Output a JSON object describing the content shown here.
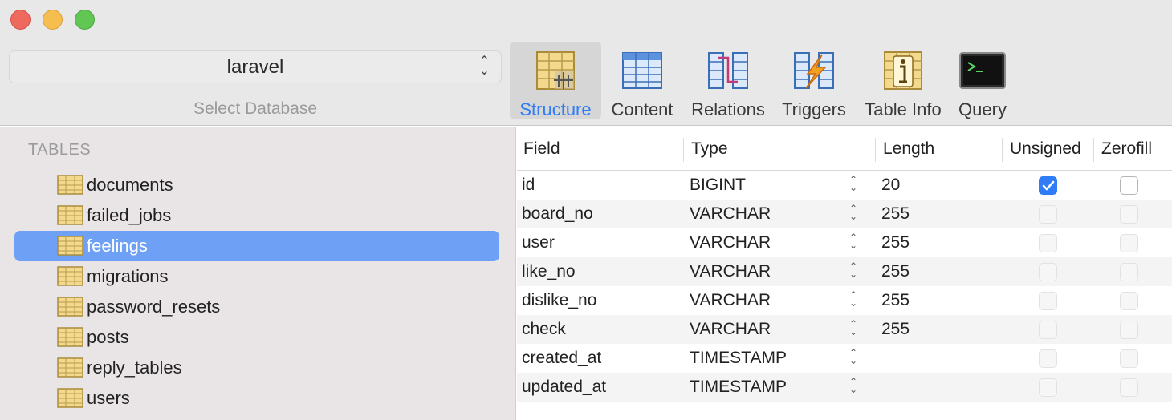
{
  "toolbar": {
    "database": {
      "value": "laravel",
      "caption": "Select Database"
    },
    "tools": [
      {
        "label": "Structure",
        "icon": "structure-icon",
        "active": true
      },
      {
        "label": "Content",
        "icon": "content-icon"
      },
      {
        "label": "Relations",
        "icon": "relations-icon"
      },
      {
        "label": "Triggers",
        "icon": "triggers-icon"
      },
      {
        "label": "Table Info",
        "icon": "table-info-icon"
      },
      {
        "label": "Query",
        "icon": "query-icon"
      }
    ]
  },
  "sidebar": {
    "heading": "TABLES",
    "tables": [
      "documents",
      "failed_jobs",
      "feelings",
      "migrations",
      "password_resets",
      "posts",
      "reply_tables",
      "users"
    ],
    "selected": "feelings"
  },
  "structure": {
    "columns": [
      "Field",
      "Type",
      "Length",
      "Unsigned",
      "Zerofill"
    ],
    "rows": [
      {
        "field": "id",
        "type": "BIGINT",
        "length": "20",
        "unsigned": true,
        "zerofill": false,
        "enabled": true
      },
      {
        "field": "board_no",
        "type": "VARCHAR",
        "length": "255",
        "unsigned": false,
        "zerofill": false,
        "enabled": false
      },
      {
        "field": "user",
        "type": "VARCHAR",
        "length": "255",
        "unsigned": false,
        "zerofill": false,
        "enabled": false
      },
      {
        "field": "like_no",
        "type": "VARCHAR",
        "length": "255",
        "unsigned": false,
        "zerofill": false,
        "enabled": false
      },
      {
        "field": "dislike_no",
        "type": "VARCHAR",
        "length": "255",
        "unsigned": false,
        "zerofill": false,
        "enabled": false
      },
      {
        "field": "check",
        "type": "VARCHAR",
        "length": "255",
        "unsigned": false,
        "zerofill": false,
        "enabled": false
      },
      {
        "field": "created_at",
        "type": "TIMESTAMP",
        "length": "",
        "unsigned": false,
        "zerofill": false,
        "enabled": false
      },
      {
        "field": "updated_at",
        "type": "TIMESTAMP",
        "length": "",
        "unsigned": false,
        "zerofill": false,
        "enabled": false
      }
    ]
  },
  "colors": {
    "accent": "#2f7cf6",
    "selection": "#6ea0f6"
  }
}
